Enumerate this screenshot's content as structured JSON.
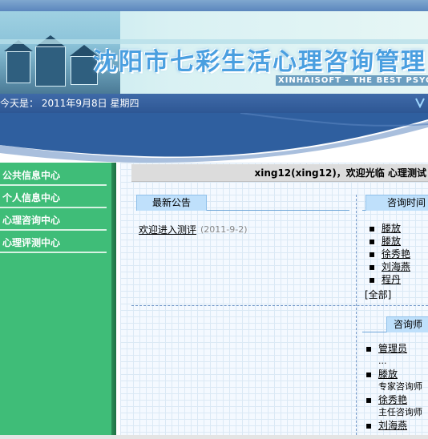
{
  "banner": {
    "title": "沈阳市七彩生活心理咨询管理",
    "subtitle": "XINHAISOFT - THE BEST PSYCHO"
  },
  "datebar": {
    "text": "今天是： 2011年9月8日 星期四"
  },
  "sidebar": {
    "items": [
      {
        "label": "公共信息中心"
      },
      {
        "label": "个人信息中心"
      },
      {
        "label": "心理咨询中心"
      },
      {
        "label": "心理评测中心"
      }
    ]
  },
  "welcome": {
    "text": "xing12(xing12)，欢迎光临 心理测试"
  },
  "notices": {
    "tab": "最新公告",
    "items": [
      {
        "title": "欢迎进入测评",
        "date": "(2011-9-2)"
      }
    ]
  },
  "consult_time": {
    "tab": "咨询时间",
    "items": [
      {
        "name": "滕放"
      },
      {
        "name": "滕放"
      },
      {
        "name": "徐秀艳"
      },
      {
        "name": "刘海燕"
      },
      {
        "name": "程丹"
      }
    ],
    "more": "[全部]"
  },
  "counselors": {
    "tab": "咨询师",
    "items": [
      {
        "name": "管理员",
        "role": "..."
      },
      {
        "name": "滕放",
        "role": "专家咨询师"
      },
      {
        "name": "徐秀艳",
        "role": "主任咨询师"
      },
      {
        "name": "刘海燕",
        "role": ""
      }
    ]
  },
  "colors": {
    "sidebar": "#3fbd78",
    "datebar": "#2e5794",
    "tab": "#bfe0fb"
  },
  "icons": [
    "bullet-icon",
    "corner-logo-icon"
  ]
}
